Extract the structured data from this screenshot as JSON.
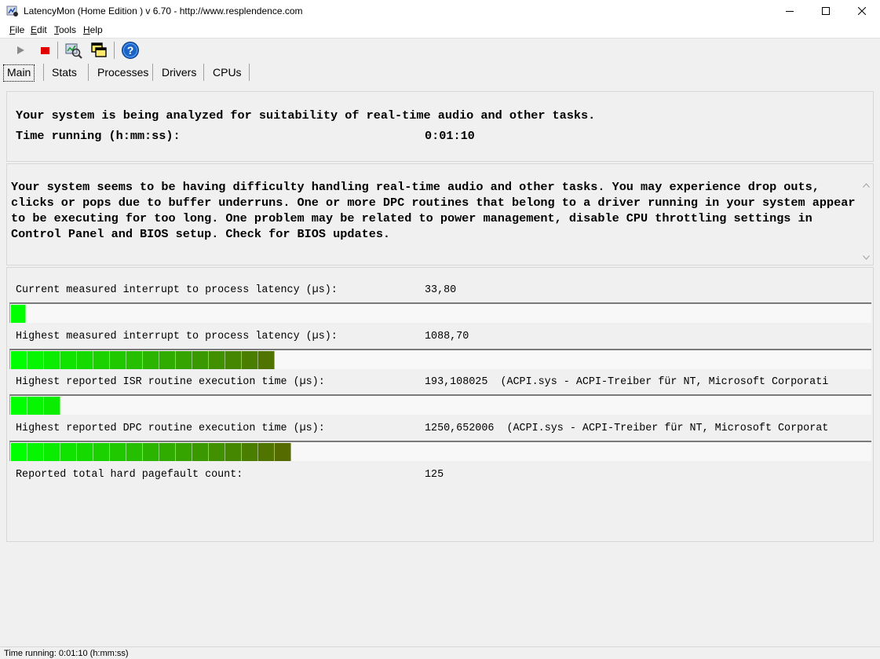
{
  "window": {
    "title": "LatencyMon  (Home Edition )  v 6.70 - http://www.resplendence.com",
    "icons": {
      "app": "app-icon",
      "minimize": "minimize-icon",
      "maximize": "maximize-icon",
      "close": "close-icon"
    }
  },
  "menu": [
    {
      "u": "F",
      "rest": "ile"
    },
    {
      "u": "E",
      "rest": "dit"
    },
    {
      "u": "T",
      "rest": "ools"
    },
    {
      "u": "H",
      "rest": "elp"
    }
  ],
  "toolbar": {
    "icons": [
      "play-icon",
      "stop-icon",
      "analyzer-icon",
      "windows-icon",
      "help-icon"
    ],
    "colors": {
      "play": "#8a8a8a",
      "stop": "#e00000",
      "help": "#1a64c8"
    }
  },
  "tabs": [
    {
      "label": "Main",
      "active": true
    },
    {
      "label": "Stats"
    },
    {
      "label": "Processes"
    },
    {
      "label": "Drivers"
    },
    {
      "label": "CPUs"
    }
  ],
  "main": {
    "analysis_line": "Your system is being analyzed for suitability of real-time audio and other tasks.",
    "time_label": "Time running (h:mm:ss):",
    "time_value": "0:01:10"
  },
  "message": {
    "text": "Your system seems to be having difficulty handling real-time audio and other tasks. You may experience drop outs, clicks or pops due to buffer underruns. One or more DPC routines that belong to a driver running in your system appear to be executing for too long. One problem may be related to power management, disable CPU throttling settings in Control Panel and BIOS setup. Check for BIOS updates."
  },
  "metrics": [
    {
      "label": "Current measured interrupt to process latency (µs):",
      "value": "33,80",
      "detail": "",
      "bar_cells": 1
    },
    {
      "label": "Highest measured interrupt to process latency (µs):",
      "value": "1088,70",
      "detail": "",
      "bar_cells": 16
    },
    {
      "label": "Highest reported ISR routine execution time (µs):",
      "value": "193,108025",
      "detail": "(ACPI.sys - ACPI-Treiber für NT, Microsoft Corporati",
      "bar_cells": 3
    },
    {
      "label": "Highest reported DPC routine execution time (µs):",
      "value": "1250,652006",
      "detail": "(ACPI.sys - ACPI-Treiber für NT, Microsoft Corporat",
      "bar_cells": 17
    },
    {
      "label": "Reported total hard pagefault count:",
      "value": "125",
      "detail": "",
      "bar_cells": 0
    }
  ],
  "bar_colors": {
    "start": "#00ff00",
    "end": "#556b00"
  },
  "status": {
    "text": "Time running: 0:01:10  (h:mm:ss)"
  }
}
